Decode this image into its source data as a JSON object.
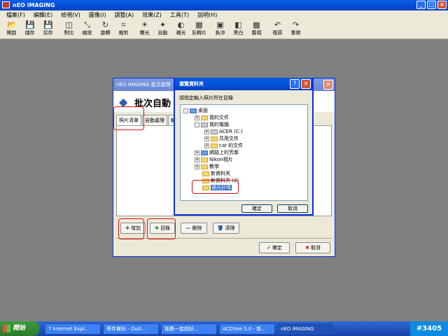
{
  "app": {
    "title": "nEO iMAGING"
  },
  "menu": [
    "檔案(F)",
    "編輯(E)",
    "檢視(V)",
    "圖像(I)",
    "調整(A)",
    "效果(Z)",
    "工具(T)",
    "說明(H)"
  ],
  "toolbar": [
    {
      "label": "開啟",
      "icon": "folder-open-icon",
      "glyph": "📂"
    },
    {
      "label": "儲存",
      "icon": "save-icon",
      "glyph": "💾"
    },
    {
      "label": "另存",
      "icon": "save-as-icon",
      "glyph": "💾"
    },
    {
      "label": "對比",
      "icon": "compare-icon",
      "glyph": "◫"
    },
    {
      "label": "縮放",
      "icon": "resize-icon",
      "glyph": "⤡"
    },
    {
      "label": "旋轉",
      "icon": "rotate-icon",
      "glyph": "↻"
    },
    {
      "label": "裁剪",
      "icon": "crop-icon",
      "glyph": "⌗"
    },
    {
      "label": "曝光",
      "icon": "exposure-icon",
      "glyph": "☀"
    },
    {
      "label": "自動",
      "icon": "auto-icon",
      "glyph": "✦"
    },
    {
      "label": "補光",
      "icon": "fill-light-icon",
      "glyph": "◐"
    },
    {
      "label": "反轉片",
      "icon": "reversal-film-icon",
      "glyph": "▦"
    },
    {
      "label": "負沖",
      "icon": "cross-process-icon",
      "glyph": "▣"
    },
    {
      "label": "黑白",
      "icon": "black-white-icon",
      "glyph": "◧"
    },
    {
      "label": "舊相",
      "icon": "sepia-icon",
      "glyph": "▩"
    },
    {
      "label": "復原",
      "icon": "undo-icon",
      "glyph": "↶"
    },
    {
      "label": "重做",
      "icon": "redo-icon",
      "glyph": "↷"
    }
  ],
  "batch_dialog": {
    "title": "nEO iMAGING 批次處理",
    "header": "批次自動",
    "tabs": [
      "照片清單",
      "自動處理",
      "輸"
    ],
    "buttons": {
      "add": "增加",
      "folder": "目錄",
      "delete": "刪除",
      "clear": "清理",
      "ok": "確定",
      "cancel": "取消"
    }
  },
  "browse_dialog": {
    "title": "瀏覽資料夾",
    "prompt": "請指定輸入照片所在目錄",
    "tree": [
      {
        "label": "桌面",
        "level": 0,
        "expander": "-",
        "icon": "desktop-icon"
      },
      {
        "label": "我的文件",
        "level": 1,
        "expander": "+",
        "icon": "folder-icon"
      },
      {
        "label": "我的電腦",
        "level": 1,
        "expander": "-",
        "icon": "computer-icon"
      },
      {
        "label": "ACER (C:)",
        "level": 2,
        "expander": "+",
        "icon": "drive-icon"
      },
      {
        "label": "共用文件",
        "level": 2,
        "expander": "+",
        "icon": "folder-icon"
      },
      {
        "label": "cat 的文件",
        "level": 2,
        "expander": "+",
        "icon": "folder-icon"
      },
      {
        "label": "網路上的芳鄰",
        "level": 1,
        "expander": "+",
        "icon": "network-icon"
      },
      {
        "label": "Nikon相片",
        "level": 1,
        "expander": "+",
        "icon": "folder-icon"
      },
      {
        "label": "教學",
        "level": 1,
        "expander": "+",
        "icon": "folder-icon"
      },
      {
        "label": "新資料夾",
        "level": 1,
        "expander": "",
        "icon": "folder-icon"
      },
      {
        "label": "新資料夾 (2)",
        "level": 1,
        "expander": "",
        "icon": "folder-icon"
      },
      {
        "label": "補光好嗎",
        "level": 1,
        "expander": "",
        "icon": "folder-icon",
        "selected": true
      }
    ],
    "ok": "確定",
    "cancel": "取消"
  },
  "taskbar": {
    "start": "開始",
    "tasks": [
      "7 Internet Expl...",
      "寄件備份 - Outl...",
      "推薦一套超好...",
      "ACDSee 5.0 - 新...",
      "nEO iMAGING"
    ],
    "tray": "#3405"
  }
}
